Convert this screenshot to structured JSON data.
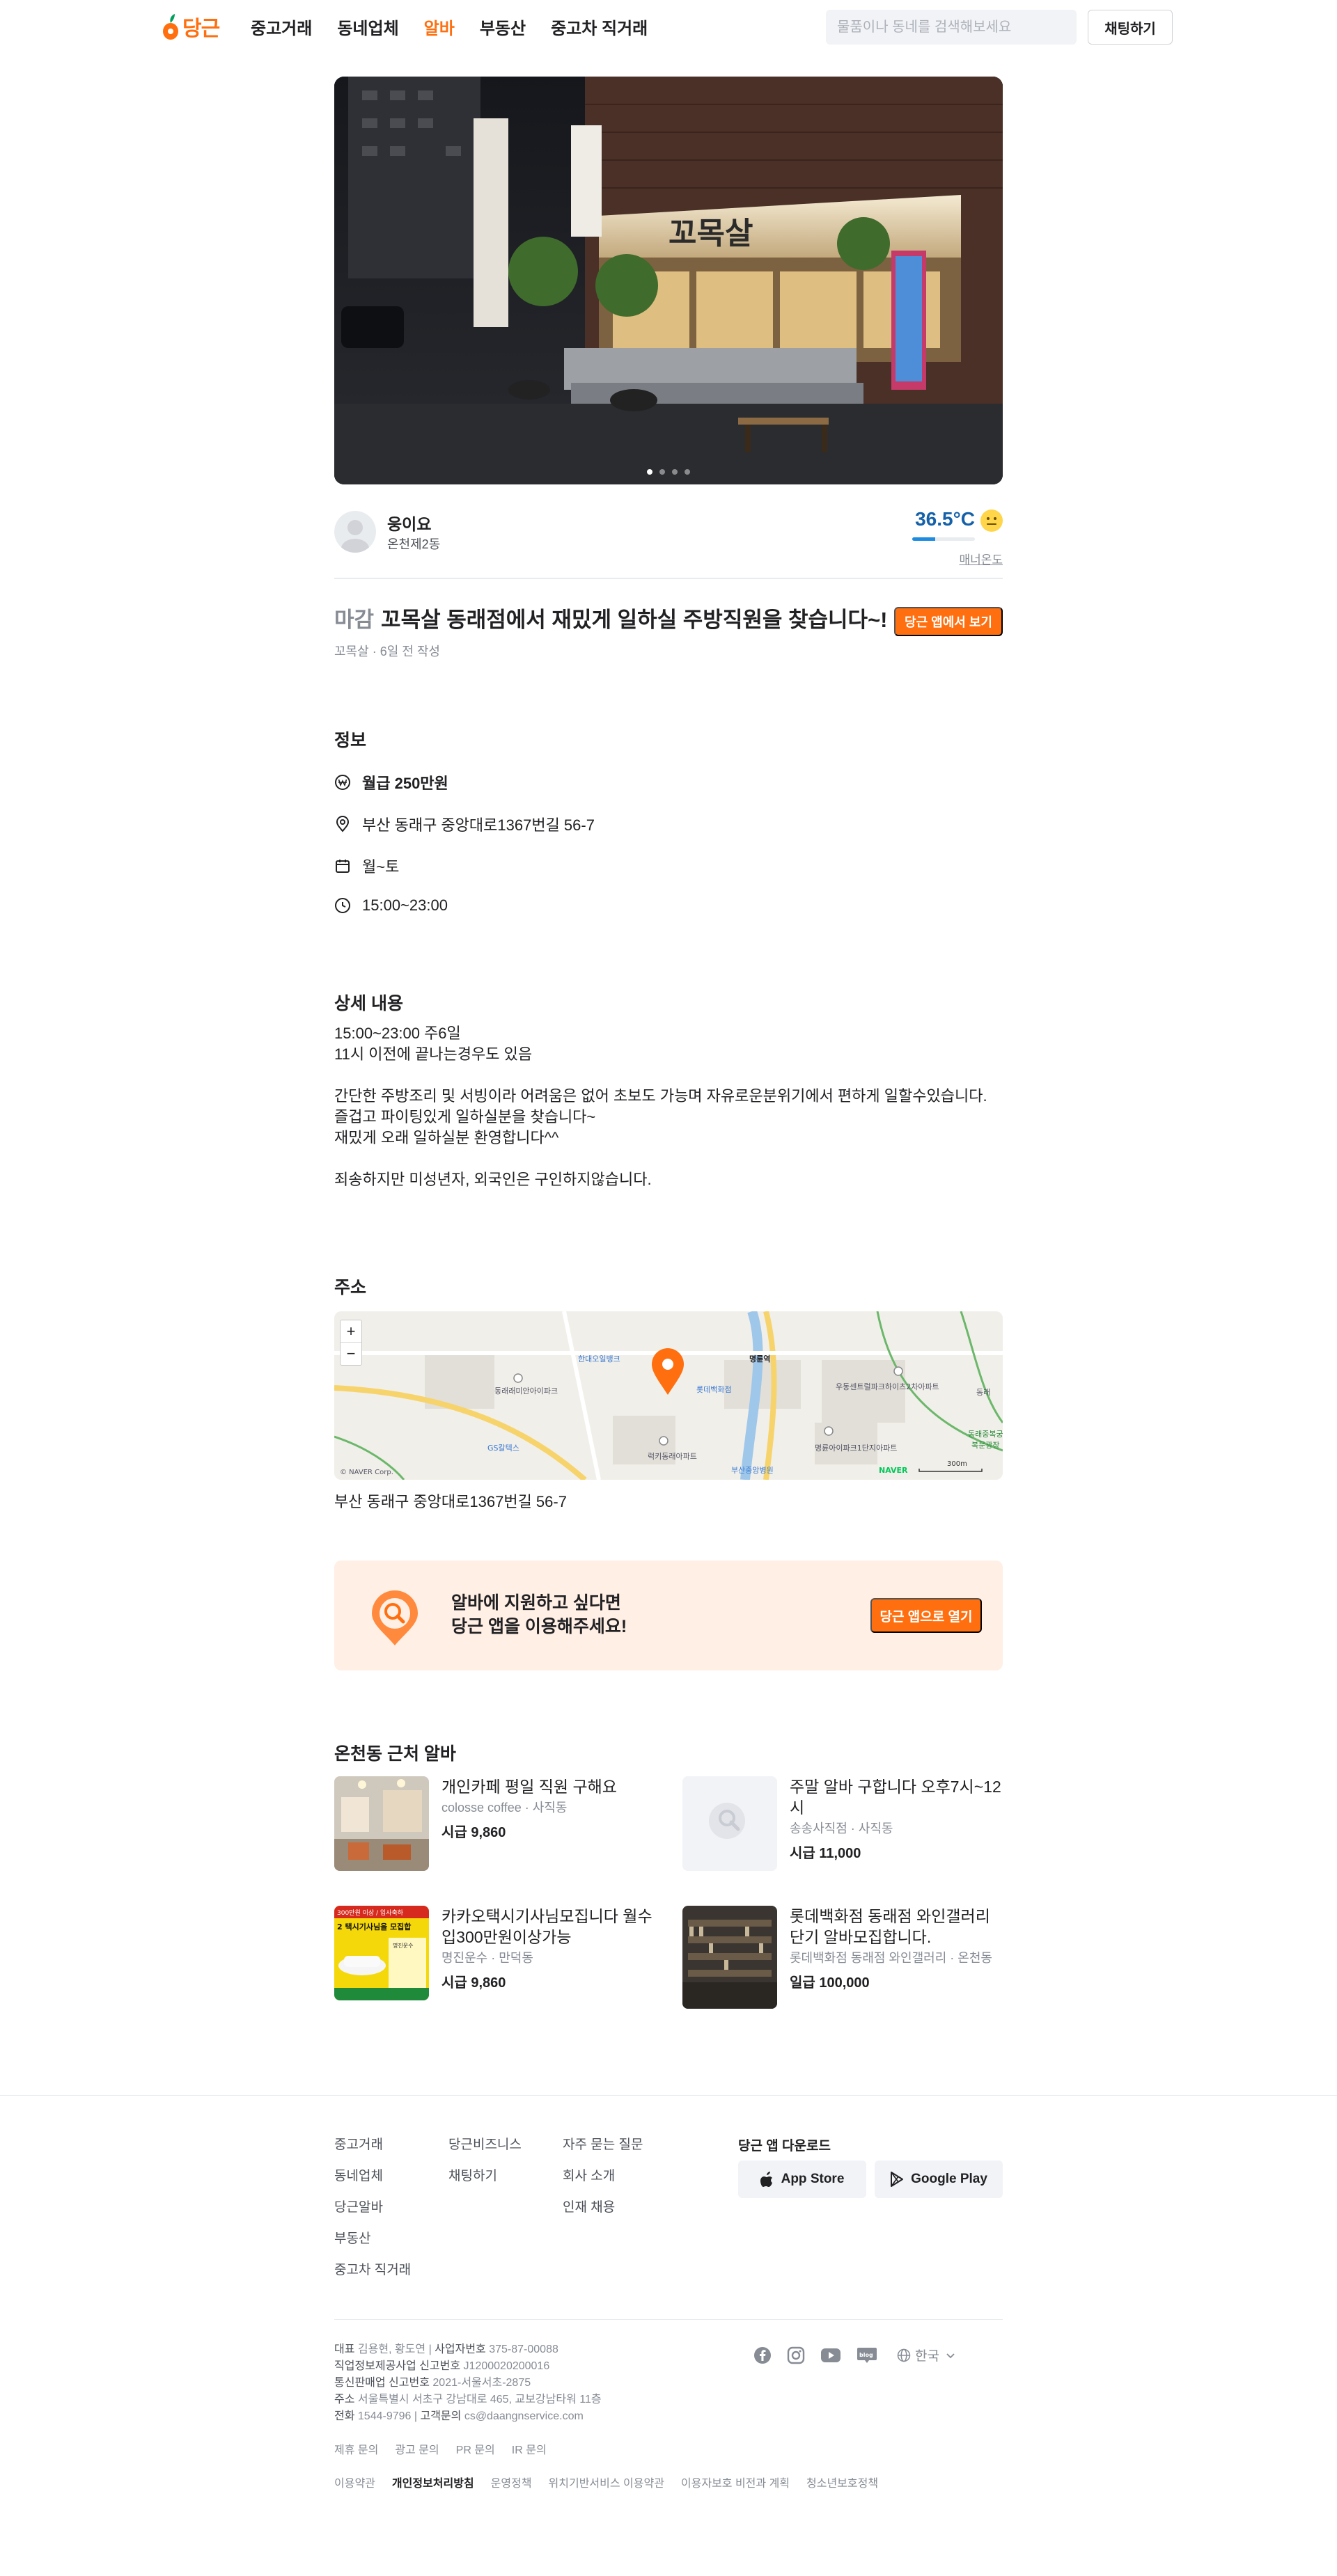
{
  "header": {
    "logo_text": "당근",
    "nav": [
      "중고거래",
      "동네업체",
      "알바",
      "부동산",
      "중고차 직거래"
    ],
    "active_nav": "알바",
    "search_placeholder": "물품이나 동네를 검색해보세요",
    "chat_button": "채팅하기"
  },
  "photo": {
    "slide_count": 4,
    "current_slide": 1,
    "sign_text": "꼬목살"
  },
  "profile": {
    "nickname": "웅이요",
    "region": "온천제2동",
    "manner_temp": "36.5°C",
    "manner_level": 0.365,
    "manner_label": "매너온도"
  },
  "post": {
    "status_tag": "마감",
    "title": "꼬목살 동래점에서 재밌게 일하실 주방직원을 찾습니다~!",
    "store": "꼬목살",
    "time_ago": "6일 전 작성",
    "app_button": "당근 앱에서 보기"
  },
  "info": {
    "section_title": "정보",
    "pay": "월급 250만원",
    "address": "부산 동래구 중앙대로1367번길 56-7",
    "days": "월~토",
    "hours": "15:00~23:00"
  },
  "detail": {
    "section_title": "상세 내용",
    "body": "15:00~23:00 주6일\n11시 이전에 끝나는경우도 있음\n\n간단한 주방조리 및 서빙이라 어려움은 없어 초보도 가능며 자유로운분위기에서 편하게 일할수있습니다.\n즐겁고 파이팅있게 일하실분을 찾습니다~\n재밌게 오래 일하실분 환영합니다^^\n\n죄송하지만 미성년자, 외국인은 구인하지않습니다."
  },
  "map_section": {
    "section_title": "주소",
    "zoom_in": "+",
    "zoom_out": "−",
    "labels": [
      "한대오일뱅크",
      "명륜역",
      "롯데백화점",
      "동래래미안아이파크",
      "우동센트럴파크하이츠2차아파트",
      "동래",
      "GS칼텍스",
      "럭키동래아파트",
      "명륜아이파크1단지아파트",
      "부산중앙병원",
      "동래중복궁",
      "복문광장"
    ],
    "copyright": "© NAVER Corp.",
    "brand": "NAVER",
    "scale": "300m",
    "address": "부산 동래구 중앙대로1367번길 56-7"
  },
  "cta": {
    "line1": "알바에 지원하고 싶다면",
    "line2": "당근 앱을 이용해주세요!",
    "button": "당근 앱으로 열기"
  },
  "nearby": {
    "section_title": "온천동 근처 알바",
    "items": [
      {
        "title": "개인카페 평일 직원 구해요",
        "sub": "colosse coffee · 사직동",
        "pay": "시급 9,860"
      },
      {
        "title": "주말 알바 구합니다 오후7시~12시",
        "sub": "송송사직점 · 사직동",
        "pay": "시급 11,000"
      },
      {
        "title": "카카오택시기사님모집니다 월수입300만원이상가능",
        "sub": "명진운수 · 만덕동",
        "pay": "시급 9,860"
      },
      {
        "title": "롯데백화점 동래점 와인갤러리 단기 알바모집합니다.",
        "sub": "롯데백화점 동래점 와인갤러리 · 온천동",
        "pay": "일급 100,000"
      }
    ],
    "thumb_texts": {
      "taxi_top": "300만원 이상 / 입사축하",
      "taxi_big": "2 택시기사님을 모집합",
      "taxi_small": "명진운수"
    }
  },
  "footer": {
    "col1": [
      "중고거래",
      "동네업체",
      "당근알바",
      "부동산",
      "중고차 직거래"
    ],
    "col2": [
      "당근비즈니스",
      "채팅하기"
    ],
    "col3": [
      "자주 묻는 질문",
      "회사 소개",
      "인재 채용"
    ],
    "download_title": "당근 앱 다운로드",
    "app_store": "App Store",
    "google_play": "Google Play",
    "corp_lines": [
      [
        "대표",
        "김용현, 황도연",
        "사업자번호",
        "375-87-00088"
      ],
      [
        "직업정보제공사업 신고번호",
        "J1200020200016"
      ],
      [
        "통신판매업 신고번호",
        "2021-서울서초-2875"
      ],
      [
        "주소",
        "서울특별시 서초구 강남대로 465, 교보강남타워 11층"
      ],
      [
        "전화",
        "1544-9796",
        "고객문의",
        "cs@daangnservice.com"
      ]
    ],
    "social": [
      "facebook-icon",
      "instagram-icon",
      "youtube-icon",
      "blog-icon"
    ],
    "blog_text": "blog",
    "language": "한국",
    "inquiry_links": [
      "제휴 문의",
      "광고 문의",
      "PR 문의",
      "IR 문의"
    ],
    "policy_links": [
      "이용약관",
      "개인정보처리방침",
      "운영정책",
      "위치기반서비스 이용약관",
      "이용자보호 비전과 계획",
      "청소년보호정책"
    ],
    "policy_strong": "개인정보처리방침"
  },
  "colors": {
    "brand": "#ff6f0f",
    "manner": "#1561a9",
    "cta_bg": "#ffefe5"
  }
}
